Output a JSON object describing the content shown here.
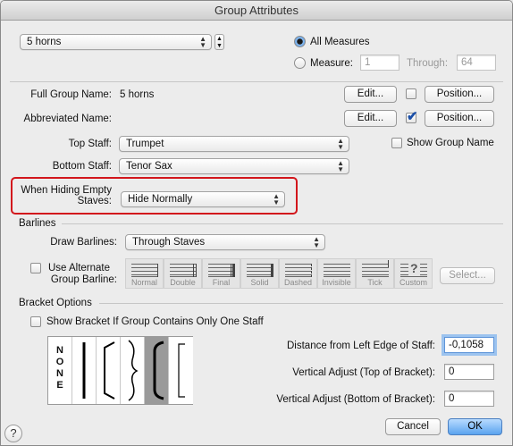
{
  "window": {
    "title": "Group Attributes"
  },
  "group_select": {
    "value": "5 horns"
  },
  "measures": {
    "all_label": "All Measures",
    "measure_label": "Measure:",
    "measure_value": "1",
    "through_label": "Through:",
    "through_value": "64"
  },
  "names": {
    "full_label": "Full Group Name:",
    "full_value": "5 horns",
    "abbr_label": "Abbreviated Name:",
    "edit_label": "Edit...",
    "position_label": "Position..."
  },
  "staves": {
    "top_label": "Top Staff:",
    "top_value": "Trumpet",
    "bottom_label": "Bottom Staff:",
    "bottom_value": "Tenor Sax",
    "show_group_name_label": "Show Group Name"
  },
  "hiding": {
    "label_line1": "When Hiding Empty",
    "label_line2": "Staves:",
    "value": "Hide Normally"
  },
  "barlines": {
    "section_title": "Barlines",
    "draw_label": "Draw Barlines:",
    "draw_value": "Through Staves",
    "use_alt_line1": "Use Alternate",
    "use_alt_line2": "Group Barline:",
    "styles": [
      "Normal",
      "Double",
      "Final",
      "Solid",
      "Dashed",
      "Invisible",
      "Tick",
      "Custom"
    ],
    "select_label": "Select..."
  },
  "bracket": {
    "section_title": "Bracket Options",
    "show_single_label": "Show Bracket If Group Contains Only One Staff",
    "none_glyph": "NONE",
    "distance_label": "Distance from Left Edge of Staff:",
    "distance_value": "-0,1058",
    "vtop_label": "Vertical Adjust (Top of Bracket):",
    "vtop_value": "0",
    "vbottom_label": "Vertical Adjust (Bottom of Bracket):",
    "vbottom_value": "0"
  },
  "footer": {
    "help_glyph": "?",
    "cancel_label": "Cancel",
    "ok_label": "OK"
  }
}
